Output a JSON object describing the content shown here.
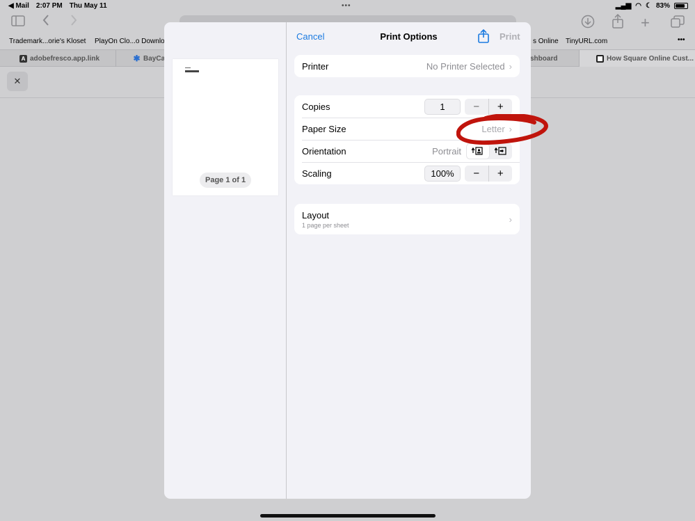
{
  "status_bar": {
    "back_app": "◀ Mail",
    "time": "2:07 PM",
    "date": "Thu May 11",
    "battery": "83%"
  },
  "toolbar": {
    "sidebar_icon": "sidebar-icon",
    "back_icon": "chevron-left-icon",
    "forward_icon": "chevron-right-icon",
    "download_icon": "download-icon",
    "share_icon": "share-icon",
    "new_tab_icon": "plus-icon",
    "tabs_icon": "tabs-icon"
  },
  "favorites": [
    {
      "label": "Trademark...orie's Kloset"
    },
    {
      "label": "PlayOn Clo...o Downloa"
    },
    {
      "label": "s Online"
    },
    {
      "label": "TinyURL.com"
    },
    {
      "label": "•••"
    }
  ],
  "tabs": [
    {
      "label": "adobefresco.app.link",
      "favicon": "A"
    },
    {
      "label": "BayCar",
      "favicon": "✱"
    },
    {
      "label": "shboard",
      "favicon": ""
    },
    {
      "label": "How Square Online Cust...",
      "favicon": "■"
    }
  ],
  "close_button": "✕",
  "print_dialog": {
    "cancel": "Cancel",
    "title": "Print Options",
    "print": "Print",
    "page_label": "Page 1 of 1",
    "printer": {
      "label": "Printer",
      "value": "No Printer Selected"
    },
    "copies": {
      "label": "Copies",
      "value": "1"
    },
    "paper_size": {
      "label": "Paper Size",
      "value": "Letter"
    },
    "orientation": {
      "label": "Orientation",
      "value": "Portrait"
    },
    "scaling": {
      "label": "Scaling",
      "value": "100%"
    },
    "layout": {
      "label": "Layout",
      "sub": "1 page per sheet"
    },
    "minus": "−",
    "plus": "+",
    "chevron": "›"
  },
  "colors": {
    "accent": "#1a7ae0",
    "annotation": "#c0140c"
  }
}
